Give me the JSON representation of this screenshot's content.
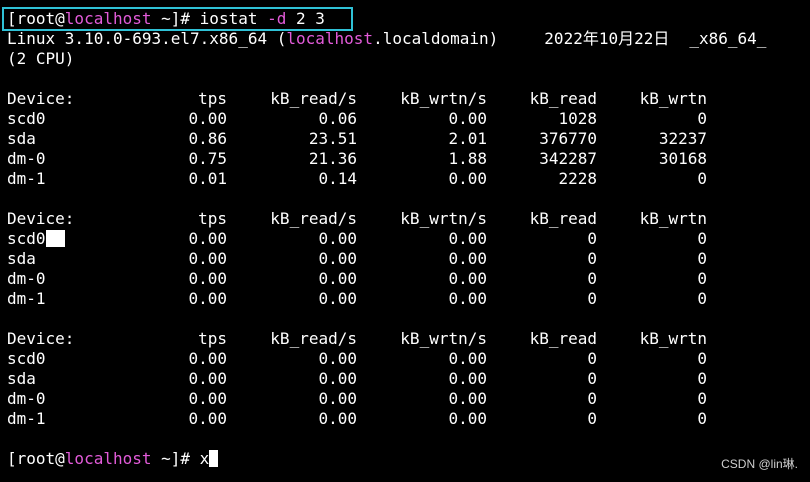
{
  "prompt": {
    "open": "[root@",
    "host": "localhost",
    "close": " ~]# "
  },
  "command": {
    "name": "iostat ",
    "flag": "-d",
    "args": " 2 3"
  },
  "system_info": {
    "kernel": "Linux 3.10.0-693.el7.x86_64 (",
    "host": "localhost",
    "domain": ".localdomain)",
    "date": "2022年10月22日",
    "arch": "_x86_64_",
    "cpu": "(2 CPU)"
  },
  "columns": [
    "Device:",
    "tps",
    "kB_read/s",
    "kB_wrtn/s",
    "kB_read",
    "kB_wrtn"
  ],
  "reports": [
    {
      "rows": [
        [
          "scd0",
          "0.00",
          "0.06",
          "0.00",
          "1028",
          "0"
        ],
        [
          "sda",
          "0.86",
          "23.51",
          "2.01",
          "376770",
          "32237"
        ],
        [
          "dm-0",
          "0.75",
          "21.36",
          "1.88",
          "342287",
          "30168"
        ],
        [
          "dm-1",
          "0.01",
          "0.14",
          "0.00",
          "2228",
          "0"
        ]
      ]
    },
    {
      "rows": [
        [
          "scd0",
          "0.00",
          "0.00",
          "0.00",
          "0",
          "0"
        ],
        [
          "sda",
          "0.00",
          "0.00",
          "0.00",
          "0",
          "0"
        ],
        [
          "dm-0",
          "0.00",
          "0.00",
          "0.00",
          "0",
          "0"
        ],
        [
          "dm-1",
          "0.00",
          "0.00",
          "0.00",
          "0",
          "0"
        ]
      ]
    },
    {
      "rows": [
        [
          "scd0",
          "0.00",
          "0.00",
          "0.00",
          "0",
          "0"
        ],
        [
          "sda",
          "0.00",
          "0.00",
          "0.00",
          "0",
          "0"
        ],
        [
          "dm-0",
          "0.00",
          "0.00",
          "0.00",
          "0",
          "0"
        ],
        [
          "dm-1",
          "0.00",
          "0.00",
          "0.00",
          "0",
          "0"
        ]
      ]
    }
  ],
  "current_input": "x",
  "watermark": "CSDN @lin琳.",
  "colors": {
    "background": "#000000",
    "text": "#ffffff",
    "hostname": "#e25bd9",
    "highlight_border": "#2fc1d6"
  }
}
